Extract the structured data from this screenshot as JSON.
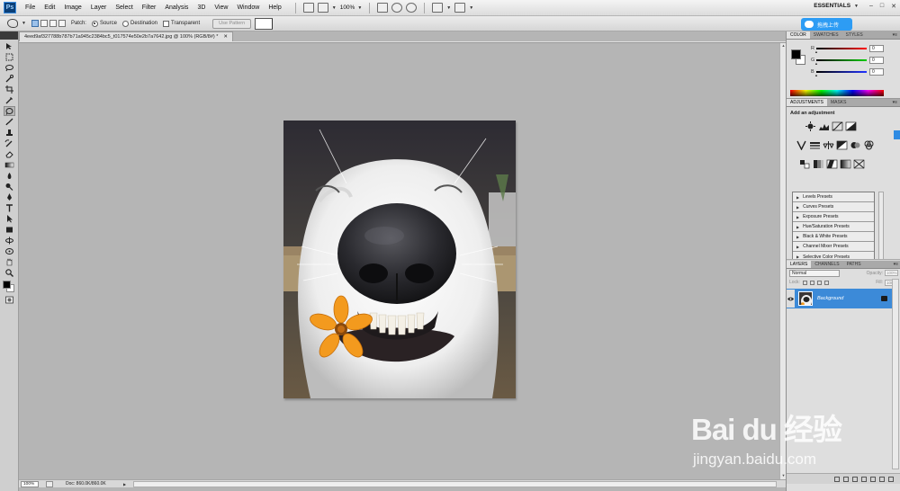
{
  "app": {
    "logo": "Ps"
  },
  "menu": [
    "File",
    "Edit",
    "Image",
    "Layer",
    "Select",
    "Filter",
    "Analysis",
    "3D",
    "View",
    "Window",
    "Help"
  ],
  "menubar": {
    "zoom": "100%",
    "workspace": "ESSENTIALS"
  },
  "options_bar": {
    "patch_label": "Patch:",
    "source_label": "Source",
    "destination_label": "Destination",
    "transparent_label": "Transparent",
    "use_pattern_label": "Use Pattern",
    "source_selected": true
  },
  "baidu_upload": {
    "label": "拖拽上传"
  },
  "document": {
    "tab_title": "4eed9af327788b787b71a945c2384bc5_t017574e50e2b7a7642.jpg @ 100% (RGB/8#) *",
    "status_zoom": "100%",
    "status_doc": "Doc: 860.0K/860.0K"
  },
  "color_panel": {
    "tabs": [
      "COLOR",
      "SWATCHES",
      "STYLES"
    ],
    "channels": [
      {
        "label": "R",
        "value": "0",
        "color": "#e03030"
      },
      {
        "label": "G",
        "value": "0",
        "color": "#30b030"
      },
      {
        "label": "B",
        "value": "0",
        "color": "#3050e0"
      }
    ]
  },
  "adjustments_panel": {
    "tabs": [
      "ADJUSTMENTS",
      "MASKS"
    ],
    "title": "Add an adjustment",
    "presets": [
      "Levels Presets",
      "Curves Presets",
      "Exposure Presets",
      "Hue/Saturation Presets",
      "Black & White Presets",
      "Channel Mixer Presets",
      "Selective Color Presets"
    ]
  },
  "layers_panel": {
    "tabs": [
      "LAYERS",
      "CHANNELS",
      "PATHS"
    ],
    "blend_mode": "Normal",
    "opacity_label": "Opacity:",
    "opacity_value": "100%",
    "lock_label": "Lock:",
    "fill_label": "Fill:",
    "fill_value": "100%",
    "layers": [
      {
        "name": "Background",
        "selected": true
      }
    ]
  },
  "watermark": {
    "main": "Bai du 经验",
    "sub": "jingyan.baidu.com"
  },
  "colors": {
    "accent": "#3c8ad8",
    "baidu_blue": "#2d9cf4"
  }
}
